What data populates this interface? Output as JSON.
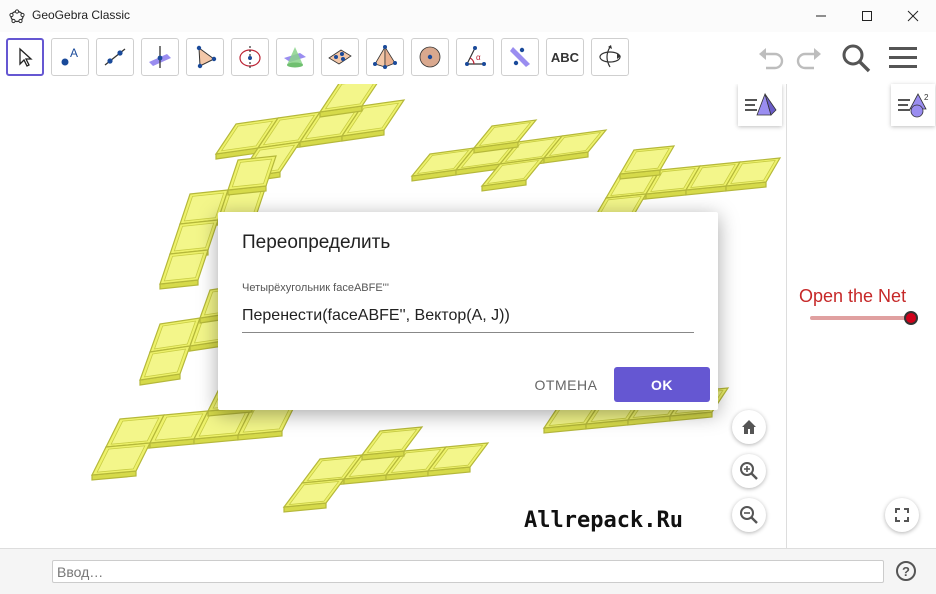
{
  "window": {
    "title": "GeoGebra Classic"
  },
  "toolbar": {
    "tools": [
      {
        "name": "move-tool"
      },
      {
        "name": "point-tool"
      },
      {
        "name": "line-tool"
      },
      {
        "name": "perpendicular-tool"
      },
      {
        "name": "polygon-tool"
      },
      {
        "name": "circle-axis-tool"
      },
      {
        "name": "intersect-surfaces-tool"
      },
      {
        "name": "plane-tool"
      },
      {
        "name": "pyramid-tool"
      },
      {
        "name": "sphere-tool"
      },
      {
        "name": "angle-tool"
      },
      {
        "name": "reflect-tool"
      },
      {
        "name": "text-tool",
        "label": "ABC"
      },
      {
        "name": "rotate-view-tool"
      }
    ]
  },
  "dialog": {
    "title": "Переопределить",
    "field_label": "Четырёхугольник faceABFE'''",
    "field_value": "Перенести(faceABFE'', Вектор(A, J))",
    "cancel_label": "ОТМЕНА",
    "ok_label": "OK"
  },
  "sidebar": {
    "slider_label": "Open the Net",
    "slider_value": 1.0
  },
  "watermark": "Allrepack.Ru",
  "input_bar": {
    "placeholder": "Ввод…"
  },
  "colors": {
    "accent": "#6557d2",
    "net_fill": "#eef26b",
    "slider_red": "#d0021b",
    "slider_label": "#c62828"
  }
}
